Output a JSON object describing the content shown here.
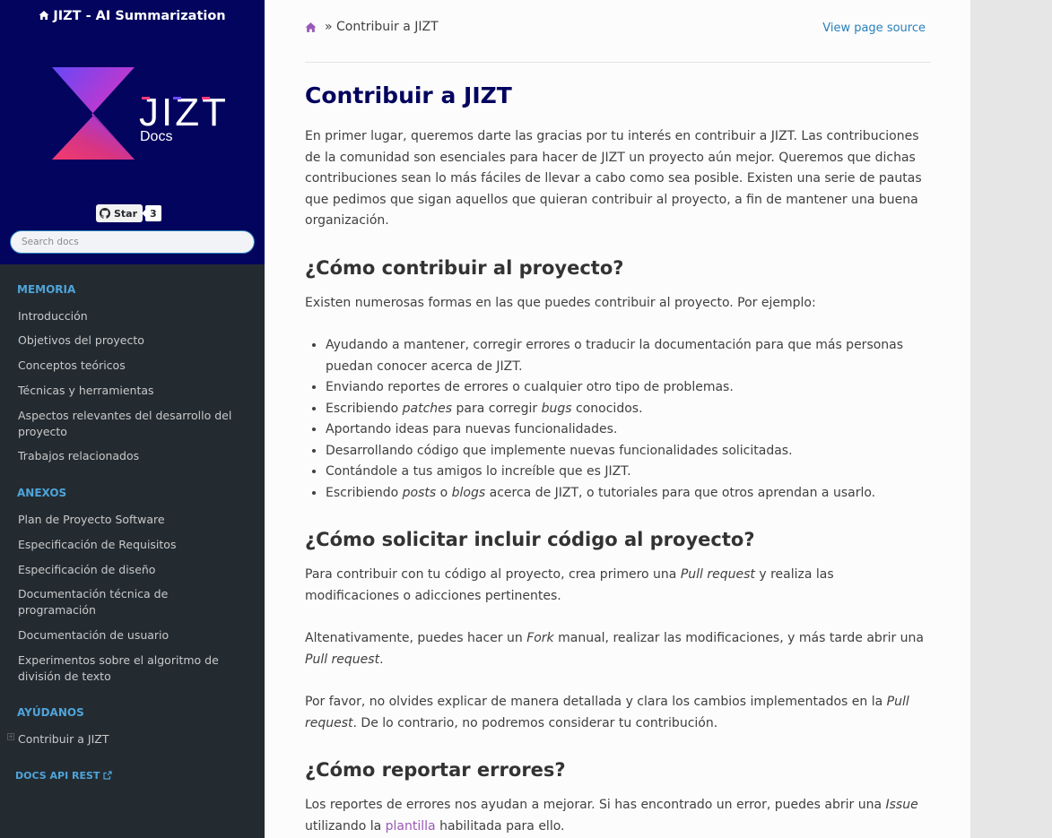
{
  "sidebar": {
    "project_title": "JIZT - AI Summarization",
    "logo_text": "JIZT",
    "logo_subtext": "Docs",
    "star_label": "Star",
    "star_count": "3",
    "search_placeholder": "Search docs",
    "sections": [
      {
        "caption": "MEMORIA",
        "items": [
          "Introducción",
          "Objetivos del proyecto",
          "Conceptos teóricos",
          "Técnicas y herramientas",
          "Aspectos relevantes del desarrollo del proyecto",
          "Trabajos relacionados"
        ]
      },
      {
        "caption": "ANEXOS",
        "items": [
          "Plan de Proyecto Software",
          "Especificación de Requisitos",
          "Especificación de diseño",
          "Documentación técnica de programación",
          "Documentación de usuario",
          "Experimentos sobre el algoritmo de división de texto"
        ]
      },
      {
        "caption": "AYÚDANOS",
        "items": [
          "Contribuir a JIZT"
        ]
      }
    ],
    "api_link": "DOCS API REST"
  },
  "header": {
    "breadcrumb_sep": "»",
    "breadcrumb_current": "Contribuir a JIZT",
    "view_source": "View page source"
  },
  "article": {
    "title": "Contribuir a JIZT",
    "intro": "En primer lugar, queremos darte las gracias por tu interés en contribuir a JIZT. Las contribuciones de la comunidad son esenciales para hacer de JIZT un proyecto aún mejor. Queremos que dichas contribuciones sean lo más fáciles de llevar a cabo como sea posible. Existen una serie de pautas que pedimos que sigan aquellos que quieran contribuir al proyecto, a fin de mantener una buena organización.",
    "h2_how": "¿Cómo contribuir al proyecto?",
    "how_text": "Existen numerosas formas en las que puedes contribuir al proyecto. Por ejemplo:",
    "li1": "Ayudando a mantener, corregir errores o traducir la documentación para que más personas puedan conocer acerca de JIZT.",
    "li2": "Enviando reportes de errores o cualquier otro tipo de problemas.",
    "li3_a": "Escribiendo ",
    "li3_b": "patches",
    "li3_c": " para corregir ",
    "li3_d": "bugs",
    "li3_e": " conocidos.",
    "li4": "Aportando ideas para nuevas funcionalidades.",
    "li5": "Desarrollando código que implemente nuevas funcionalidades solicitadas.",
    "li6": "Contándole a tus amigos lo increíble que es JIZT.",
    "li7_a": "Escribiendo ",
    "li7_b": "posts",
    "li7_c": " o ",
    "li7_d": "blogs",
    "li7_e": " acerca de JIZT, o tutoriales para que otros aprendan a usarlo.",
    "h2_request": "¿Cómo solicitar incluir código al proyecto?",
    "p1_a": "Para contribuir con tu código al proyecto, crea primero una ",
    "p1_b": "Pull request",
    "p1_c": " y realiza las modificaciones o adicciones pertinentes.",
    "p2_a": "Altenativamente, puedes hacer un ",
    "p2_b": "Fork",
    "p2_c": " manual, realizar las modificaciones, y más tarde abrir una ",
    "p2_d": "Pull request",
    "p2_e": ".",
    "p3_a": "Por favor, no olvides explicar de manera detallada y clara los cambios implementados en la ",
    "p3_b": "Pull request",
    "p3_c": ". De lo contrario, no podremos considerar tu contribución.",
    "h2_report": "¿Cómo reportar errores?",
    "p4_a": "Los reportes de errores nos ayudan a mejorar. Si has encontrado un error, puedes abrir una ",
    "p4_b": "Issue",
    "p4_c": " utilizando la ",
    "p4_link": "plantilla",
    "p4_d": " habilitada para ello."
  },
  "colors": {
    "sidebar_top": "#03045e",
    "sidebar_bg": "#232b31",
    "caption": "#4fa4d9",
    "link": "#2980b9",
    "visited_link": "#9b59b6",
    "title": "#03045e"
  }
}
